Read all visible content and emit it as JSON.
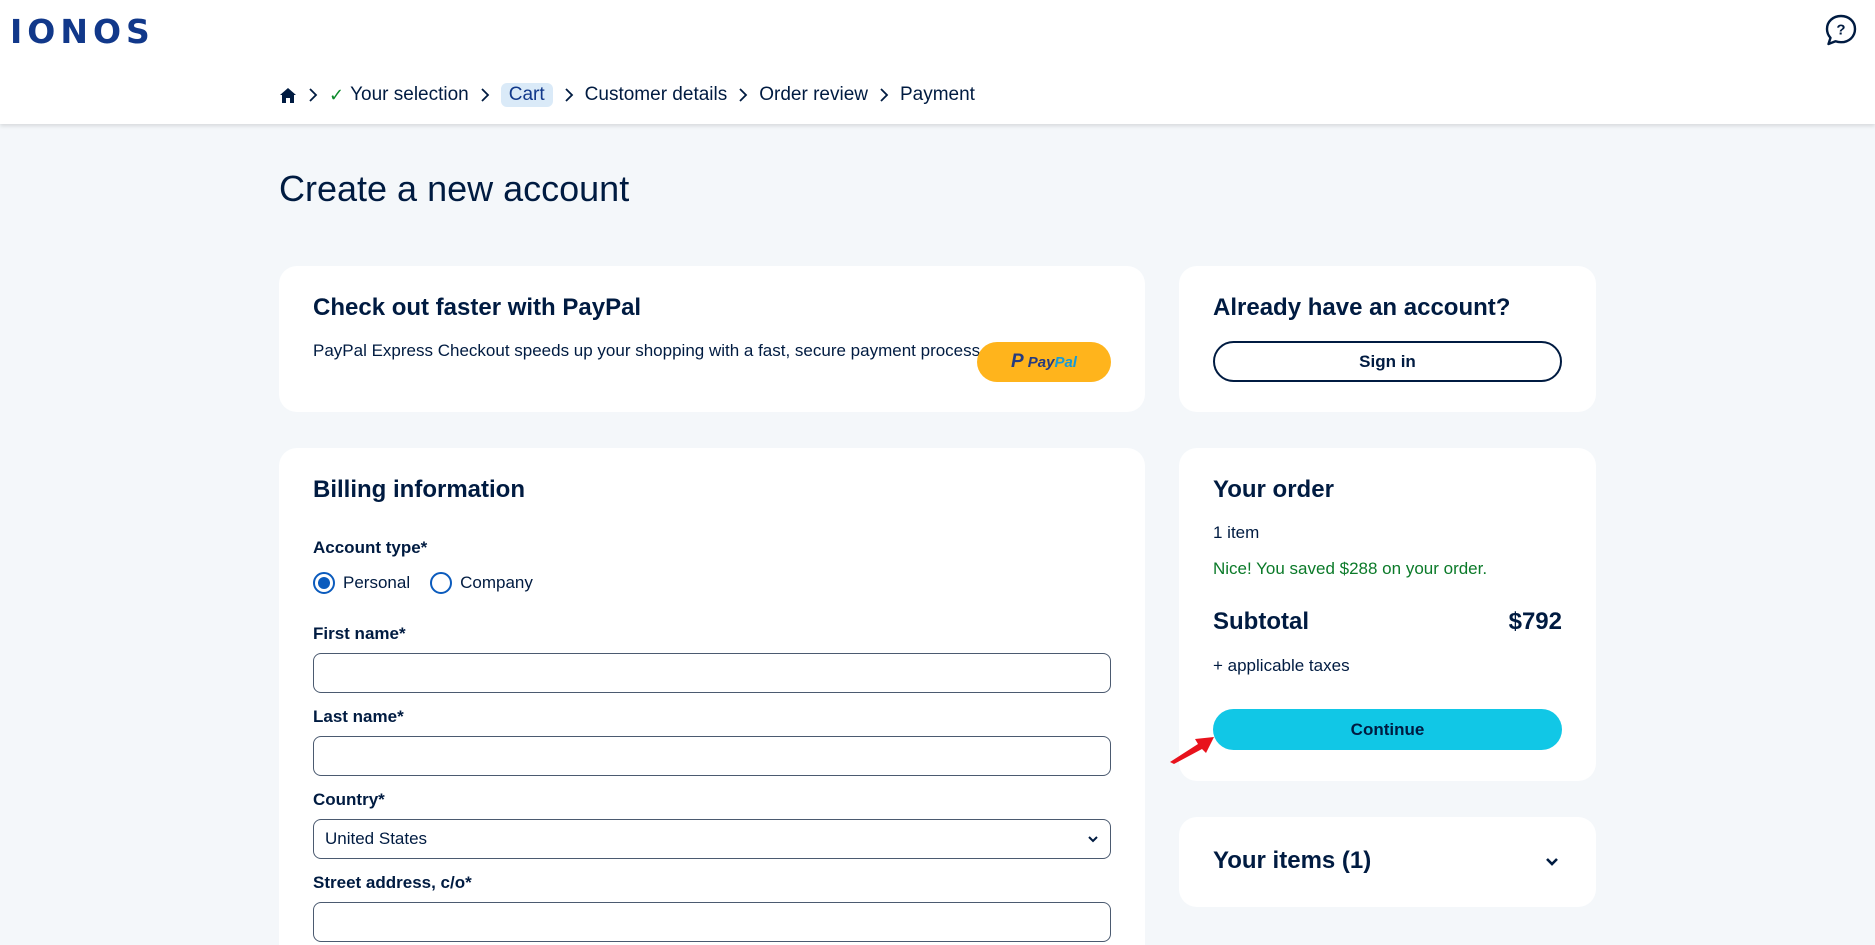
{
  "header": {
    "logo": "IONOS",
    "help_icon": "chat-help-icon"
  },
  "breadcrumb": {
    "home_icon": "home-icon",
    "items": [
      {
        "label": "Your selection",
        "state": "done"
      },
      {
        "label": "Cart",
        "state": "current"
      },
      {
        "label": "Customer details",
        "state": "pending"
      },
      {
        "label": "Order review",
        "state": "pending"
      },
      {
        "label": "Payment",
        "state": "pending"
      }
    ]
  },
  "page": {
    "title": "Create a new account"
  },
  "paypal": {
    "heading": "Check out faster with PayPal",
    "description": "PayPal Express Checkout speeds up your shopping with a fast, secure payment process.",
    "button_label_1": "Pay",
    "button_label_2": "Pal"
  },
  "account": {
    "heading": "Already have an account?",
    "signin_label": "Sign in"
  },
  "billing": {
    "heading": "Billing information",
    "account_type_label": "Account type*",
    "account_types": [
      "Personal",
      "Company"
    ],
    "selected_account_type": "Personal",
    "first_name_label": "First name*",
    "first_name_value": "",
    "last_name_label": "Last name*",
    "last_name_value": "",
    "country_label": "Country*",
    "country_value": "United States",
    "street_label": "Street address, c/o*",
    "street_value": ""
  },
  "order": {
    "heading": "Your order",
    "items_count": "1 item",
    "saved_message": "Nice! You saved $288 on your order.",
    "subtotal_label": "Subtotal",
    "subtotal_value": "$792",
    "taxes_note": "+ applicable taxes",
    "continue_label": "Continue"
  },
  "items": {
    "heading": "Your items (1)"
  },
  "colors": {
    "brand": "#11388a",
    "accent_button": "#11c7e6",
    "paypal_button": "#ffb41c",
    "success_text": "#0b7a29",
    "annotation_arrow": "#e8121c"
  }
}
